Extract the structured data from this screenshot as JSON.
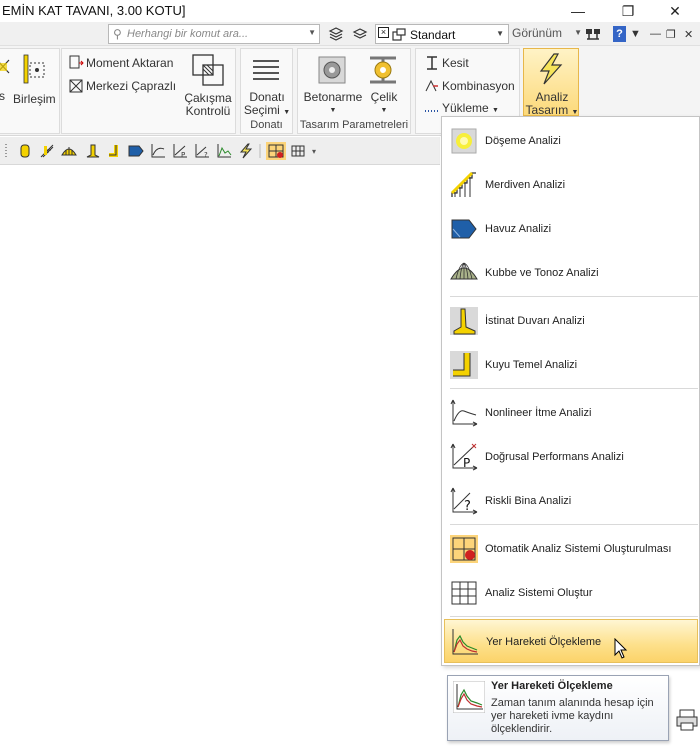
{
  "window": {
    "title": "EMİN KAT TAVANI,  3.00 KOTU]",
    "minimize_glyph": "—",
    "maximize_glyph": "❐",
    "close_glyph": "✕"
  },
  "quickbar": {
    "search_placeholder": "Herhangi bir komut ara...",
    "style_value": "Standart",
    "view_label": "Görünüm",
    "help_glyph": "?"
  },
  "ribbon": {
    "birlesim": "Birleşim",
    "left_cut": "s",
    "moment_aktaran": "Moment Aktaran",
    "merkezi_caprazli": "Merkezi Çaprazlı",
    "cakisma_l1": "Çakışma",
    "cakisma_l2": "Kontrolü",
    "donati_secimi_l1": "Donatı",
    "donati_secimi_l2": "Seçimi",
    "donati_group": "Donatı",
    "betonarme": "Betonarme",
    "celik": "Çelik",
    "tasarim_group": "Tasarım Parametreleri",
    "kesit": "Kesit",
    "kombinasyon": "Kombinasyon",
    "yukleme": "Yükleme",
    "analiz_l1": "Analiz",
    "analiz_l2": "Tasarım"
  },
  "menu": {
    "items": [
      {
        "label": "Döşeme Analizi",
        "icon": "slab-analysis-icon"
      },
      {
        "label": "Merdiven Analizi",
        "icon": "stair-analysis-icon"
      },
      {
        "label": "Havuz Analizi",
        "icon": "pool-analysis-icon"
      },
      {
        "label": "Kubbe ve Tonoz Analizi",
        "icon": "dome-analysis-icon"
      },
      {
        "label": "İstinat Duvarı Analizi",
        "icon": "retaining-wall-icon"
      },
      {
        "label": "Kuyu Temel Analizi",
        "icon": "well-foundation-icon"
      },
      {
        "label": "Nonlineer İtme Analizi",
        "icon": "pushover-analysis-icon"
      },
      {
        "label": "Doğrusal Performans Analizi",
        "icon": "linear-performance-icon"
      },
      {
        "label": "Riskli Bina Analizi",
        "icon": "risky-building-icon"
      },
      {
        "label": "Otomatik Analiz Sistemi Oluşturulması",
        "icon": "auto-analysis-system-icon"
      },
      {
        "label": "Analiz Sistemi Oluştur",
        "icon": "analysis-system-grid-icon"
      },
      {
        "label": "Yer Hareketi Ölçekleme",
        "icon": "ground-motion-scaling-icon"
      }
    ]
  },
  "tooltip": {
    "title": "Yer Hareketi Ölçekleme",
    "description": "Zaman tanım alanında hesap için yer hareketi ivme kaydını ölçeklendirir."
  },
  "colors": {
    "highlight": "#fde08a",
    "accent_yellow": "#f4d200",
    "icon_blue": "#1f5fa8"
  }
}
